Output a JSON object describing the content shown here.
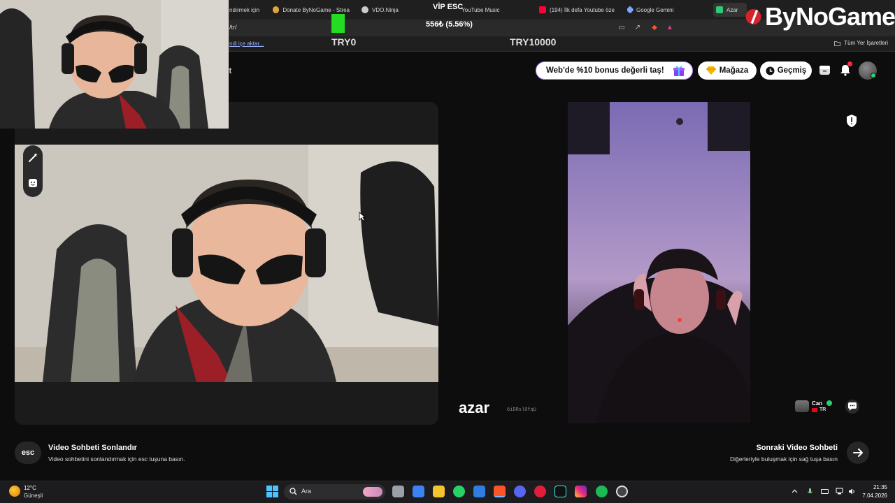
{
  "browser": {
    "tabs": [
      {
        "label": "ndırmek için",
        "icon": "tab-icon"
      },
      {
        "label": "Donate ByNoGame - Strea",
        "icon": "bynogame-tab-icon"
      },
      {
        "label": "VDO.Ninja",
        "icon": "vdo-ninja-icon"
      },
      {
        "label": "YouTube Music",
        "icon": "youtube-music-icon"
      },
      {
        "label": "(194) İlk defa Youtube öze",
        "icon": "youtube-icon"
      },
      {
        "label": "Google Gemini",
        "icon": "gemini-icon"
      },
      {
        "label": "Azar",
        "icon": "azar-tab-icon"
      }
    ],
    "address": "/tr/",
    "bookmark_import": "ndi içe aktar...",
    "bookmark_all": "Tüm Yer İşaretleri"
  },
  "stream_overlay": {
    "vip_label": "VİP ESC",
    "donation_amount": "556₺ (5.56%)",
    "progress_percent": 5.56,
    "goal_min": "TRY0",
    "goal_max": "TRY10000",
    "brand": "ByNoGame"
  },
  "azar": {
    "nav_partial": "ut",
    "promo": "Web'de %10 bonus değerli taş!",
    "shop_label": "Mağaza",
    "history_label": "Geçmiş",
    "notification_count": "1",
    "logo": "azar",
    "session_id": "6iDRsl0fqU",
    "partner": {
      "name": "Can",
      "country": "TR"
    },
    "end_key": "esc",
    "end_title": "Video Sohbeti Sonlandır",
    "end_desc": "Video sohbetini sonlandırmak için esc tuşuna basın.",
    "next_title": "Sonraki Video Sohbeti",
    "next_desc": "Diğerleriyle buluşmak için sağ tuşa basın"
  },
  "taskbar": {
    "weather_temp": "12°C",
    "weather_desc": "Güneşli",
    "search_placeholder": "Ara",
    "time": "21:35",
    "date": "7.04.2026"
  },
  "colors": {
    "accent_green": "#22dd22",
    "promo_border": "#b98cff",
    "badge_red": "#ff2a40",
    "online_green": "#2ecc71"
  }
}
